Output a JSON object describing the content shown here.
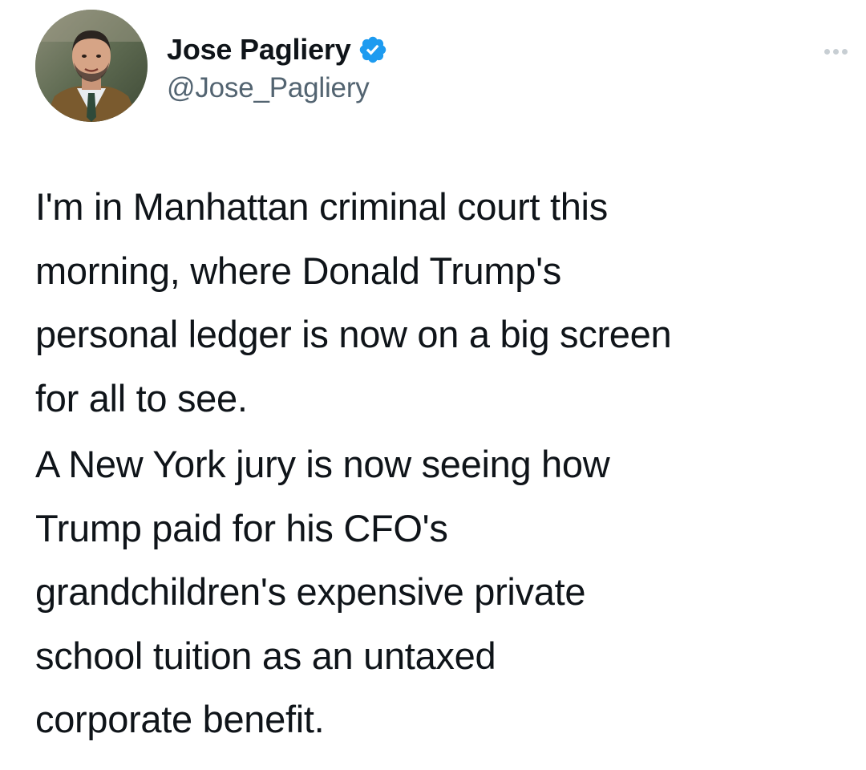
{
  "author": {
    "display_name": "Jose Pagliery",
    "handle": "@Jose_Pagliery",
    "verified": true,
    "avatar_icon": "profile-photo",
    "verified_icon": "verified-badge-icon",
    "verified_color": "#1d9bf0"
  },
  "menu": {
    "icon": "more-options-icon"
  },
  "tweet": {
    "paragraphs": [
      "I'm in Manhattan criminal court this\nmorning, where Donald Trump's\npersonal ledger is now on a big screen\nfor all to see.",
      "A New York jury is now seeing how\nTrump paid for his CFO's\ngrandchildren's expensive private\nschool tuition as an untaxed\ncorporate benefit."
    ]
  },
  "colors": {
    "text": "#0f1419",
    "secondary": "#536471",
    "background": "#ffffff",
    "accent": "#1d9bf0"
  }
}
